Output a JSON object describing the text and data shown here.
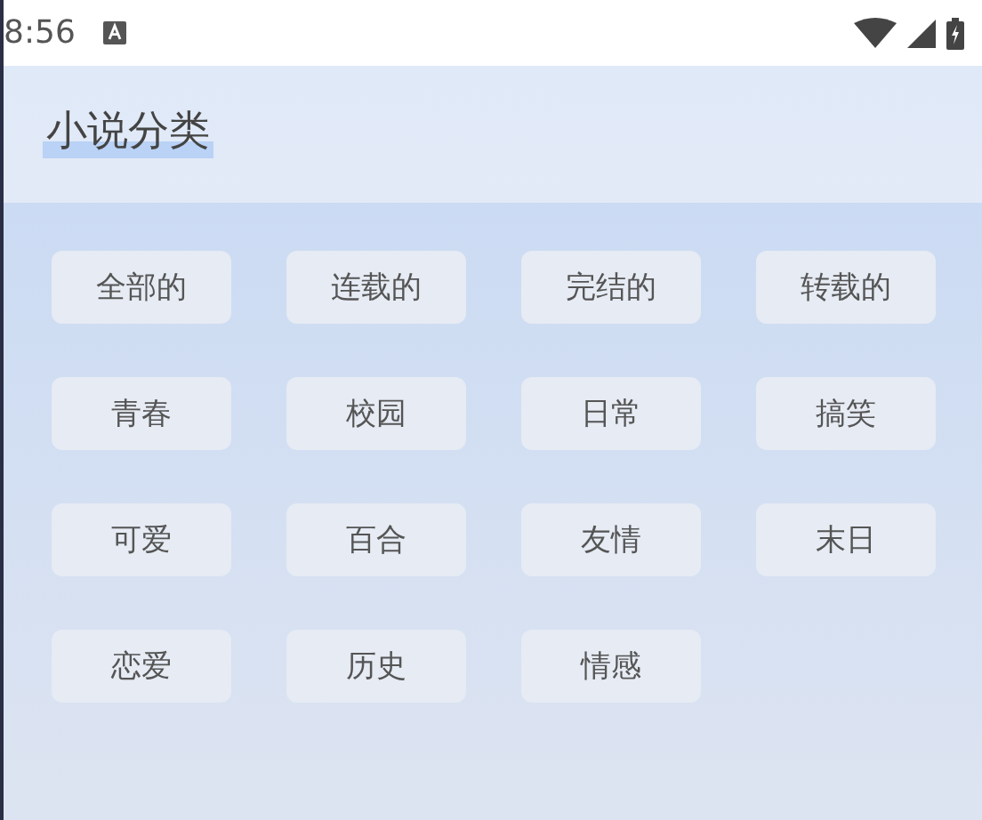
{
  "status_bar": {
    "time": "8:56"
  },
  "header": {
    "title": "小说分类"
  },
  "categories": [
    {
      "label": "全部的"
    },
    {
      "label": "连载的"
    },
    {
      "label": "完结的"
    },
    {
      "label": "转载的"
    },
    {
      "label": "青春"
    },
    {
      "label": "校园"
    },
    {
      "label": "日常"
    },
    {
      "label": "搞笑"
    },
    {
      "label": "可爱"
    },
    {
      "label": "百合"
    },
    {
      "label": "友情"
    },
    {
      "label": "末日"
    },
    {
      "label": "恋爱"
    },
    {
      "label": "历史"
    },
    {
      "label": "情感"
    }
  ]
}
